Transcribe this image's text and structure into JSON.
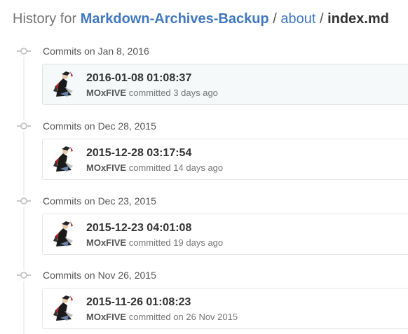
{
  "header": {
    "prefix": "History for",
    "repo": "Markdown-Archives-Backup",
    "sep1": "/",
    "folder": "about",
    "sep2": "/",
    "file": "index.md"
  },
  "groups": [
    {
      "title": "Commits on Jan 8, 2016",
      "commit": {
        "message": "2016-01-08 01:08:37",
        "author": "MOxFIVE",
        "action": "committed",
        "when": "3 days ago",
        "highlighted": true
      }
    },
    {
      "title": "Commits on Dec 28, 2015",
      "commit": {
        "message": "2015-12-28 03:17:54",
        "author": "MOxFIVE",
        "action": "committed",
        "when": "14 days ago",
        "highlighted": false
      }
    },
    {
      "title": "Commits on Dec 23, 2015",
      "commit": {
        "message": "2015-12-23 04:01:08",
        "author": "MOxFIVE",
        "action": "committed",
        "when": "19 days ago",
        "highlighted": false
      }
    },
    {
      "title": "Commits on Nov 26, 2015",
      "commit": {
        "message": "2015-11-26 01:08:23",
        "author": "MOxFIVE",
        "action": "committed",
        "when": "on 26 Nov 2015",
        "highlighted": false
      }
    }
  ],
  "colors": {
    "link": "#4078c0",
    "highlight_bg": "#f5f9fa",
    "timeline": "#f0f0f0"
  },
  "icons": {
    "timeline_marker": "git-commit-icon",
    "avatar": "author-avatar"
  }
}
